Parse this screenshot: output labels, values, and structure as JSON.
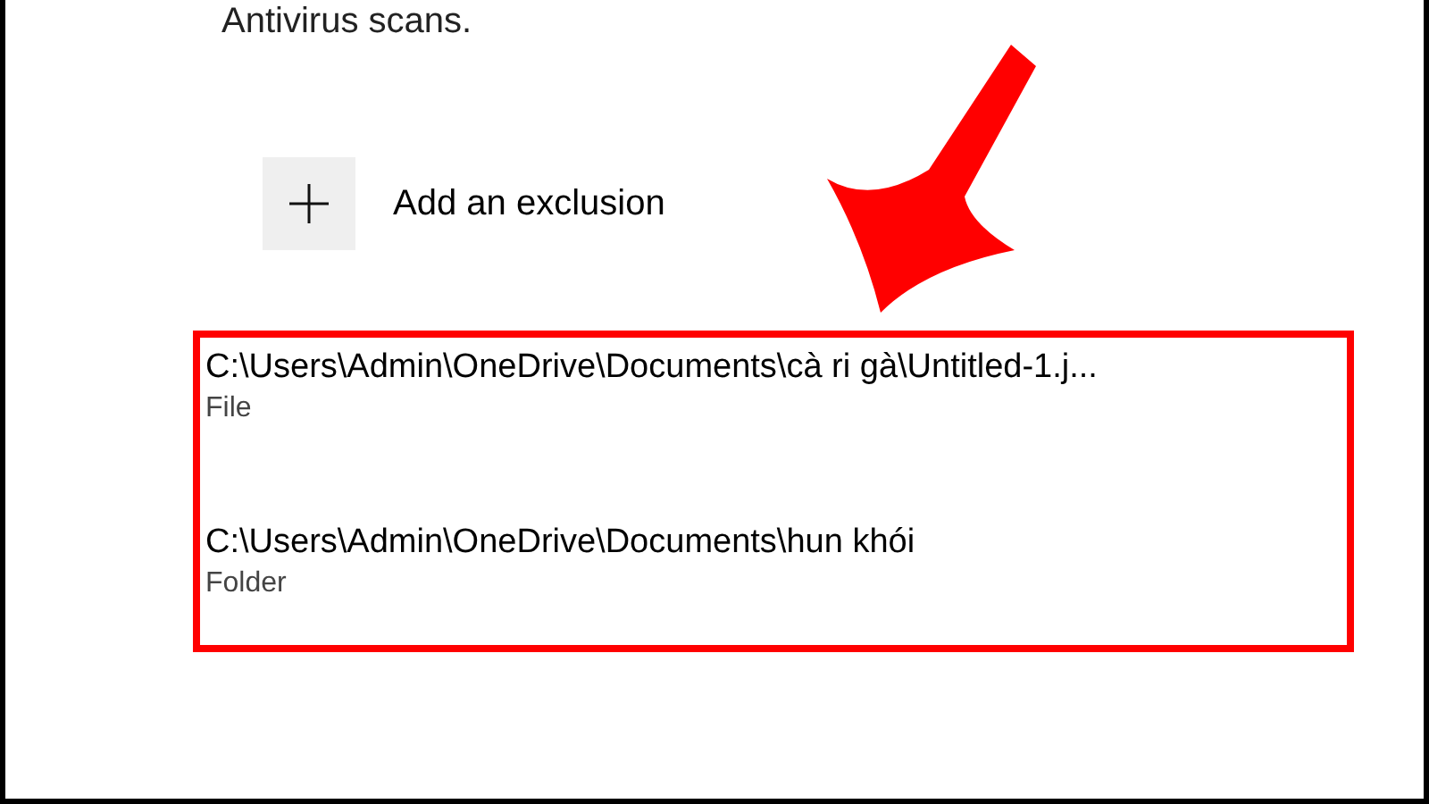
{
  "description": "Antivirus scans.",
  "add_button": {
    "label": "Add an exclusion"
  },
  "exclusions": [
    {
      "path": "C:\\Users\\Admin\\OneDrive\\Documents\\cà ri gà\\Untitled-1.j...",
      "type": "File"
    },
    {
      "path": "C:\\Users\\Admin\\OneDrive\\Documents\\hun khói",
      "type": "Folder"
    }
  ]
}
